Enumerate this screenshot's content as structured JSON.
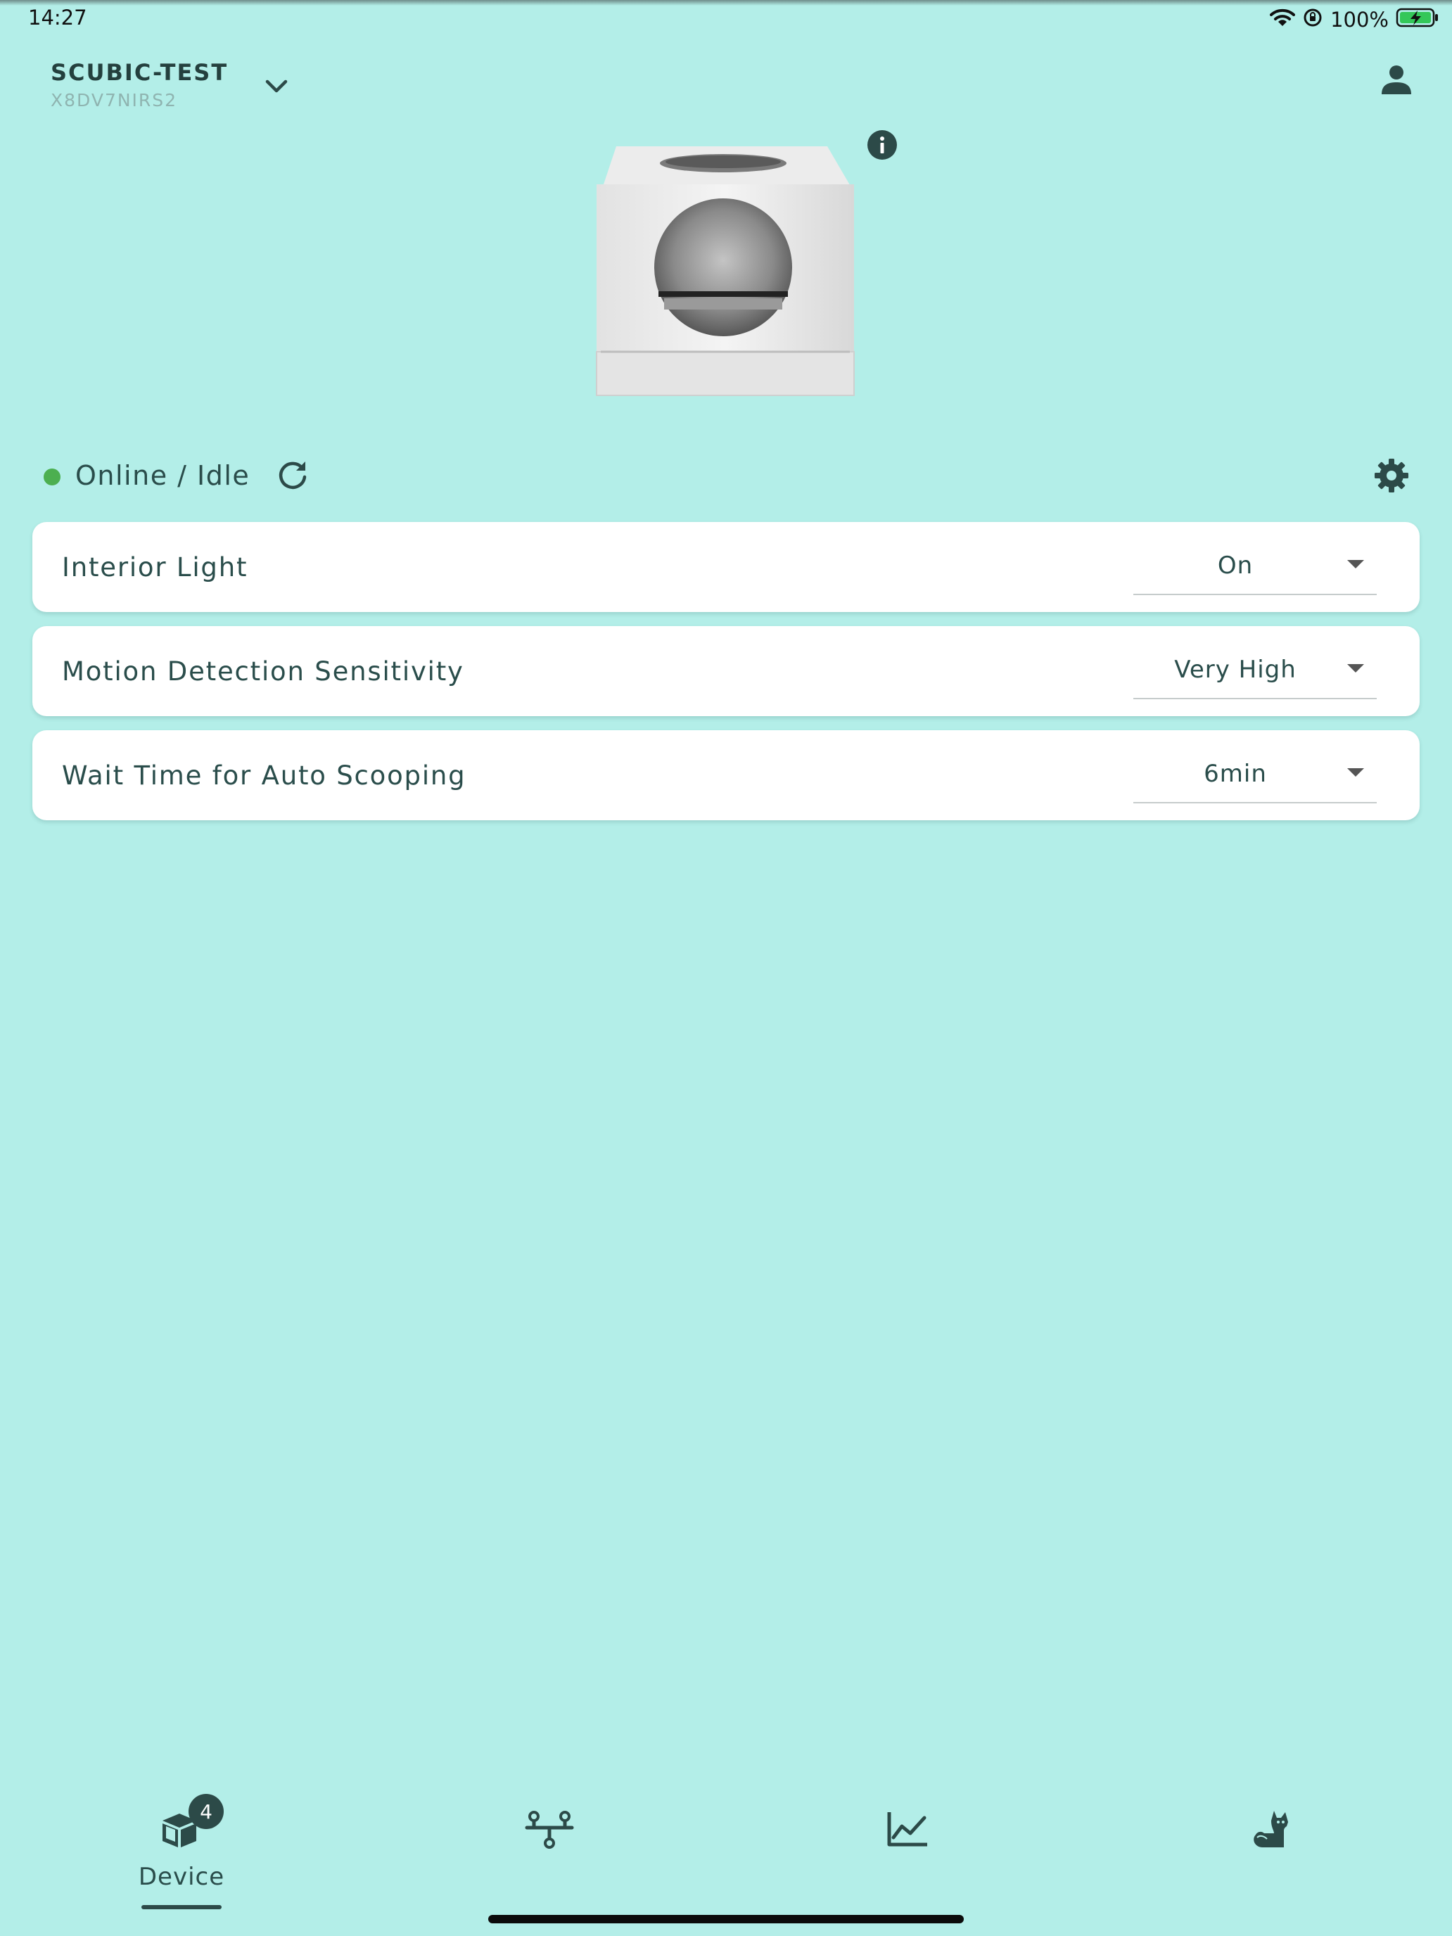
{
  "status_bar": {
    "time": "14:27",
    "battery": "100%"
  },
  "header": {
    "device_name": "SCUBIC-TEST",
    "serial": "X8DV7NIRS2"
  },
  "device_status": {
    "text": "Online / Idle",
    "color": "#4caf50"
  },
  "settings": [
    {
      "label": "Interior Light",
      "value": "On"
    },
    {
      "label": "Motion Detection Sensitivity",
      "value": "Very High"
    },
    {
      "label": "Wait Time for Auto Scooping",
      "value": "6min"
    }
  ],
  "nav": {
    "tabs": [
      {
        "label": "Device",
        "icon": "device-cube-icon",
        "badge": "4",
        "active": true
      },
      {
        "label": "",
        "icon": "network-icon",
        "active": false
      },
      {
        "label": "",
        "icon": "stats-chart-icon",
        "active": false
      },
      {
        "label": "",
        "icon": "cat-icon",
        "active": false
      }
    ]
  },
  "colors": {
    "background": "#b3eee8",
    "primary_dark": "#2c4a48",
    "online": "#4caf50",
    "battery": "#34c759"
  }
}
